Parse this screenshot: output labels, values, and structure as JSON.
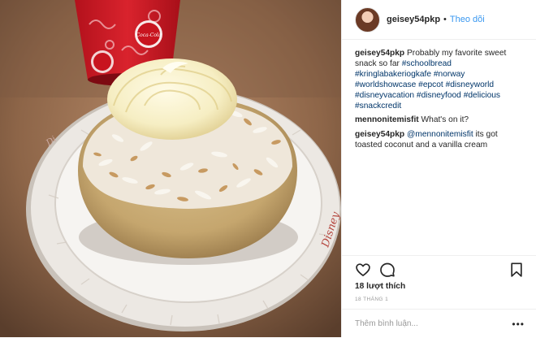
{
  "post": {
    "username": "geisey54pkp",
    "separator": "•",
    "follow_label": "Theo dõi"
  },
  "comments": [
    {
      "username": "geisey54pkp",
      "segments": [
        {
          "text": "Probably my favorite sweet snack so far ",
          "type": "text"
        },
        {
          "text": "#schoolbread",
          "type": "tag"
        },
        {
          "text": " ",
          "type": "text"
        },
        {
          "text": "#kringlabakeriogkafe",
          "type": "tag"
        },
        {
          "text": " ",
          "type": "text"
        },
        {
          "text": "#norway",
          "type": "tag"
        },
        {
          "text": " ",
          "type": "text"
        },
        {
          "text": "#worldshowcase",
          "type": "tag"
        },
        {
          "text": " ",
          "type": "text"
        },
        {
          "text": "#epcot",
          "type": "tag"
        },
        {
          "text": " ",
          "type": "text"
        },
        {
          "text": "#disneyworld",
          "type": "tag"
        },
        {
          "text": " ",
          "type": "text"
        },
        {
          "text": "#disneyvacation",
          "type": "tag"
        },
        {
          "text": " ",
          "type": "text"
        },
        {
          "text": "#disneyfood",
          "type": "tag"
        },
        {
          "text": " ",
          "type": "text"
        },
        {
          "text": "#delicious",
          "type": "tag"
        },
        {
          "text": " ",
          "type": "text"
        },
        {
          "text": "#snackcredit",
          "type": "tag"
        }
      ]
    },
    {
      "username": "mennonitemisfit",
      "segments": [
        {
          "text": "What's on it?",
          "type": "text"
        }
      ]
    },
    {
      "username": "geisey54pkp",
      "segments": [
        {
          "text": "@mennonitemisfit",
          "type": "tag"
        },
        {
          "text": " its got toasted coconut and a vanilla cream",
          "type": "text"
        }
      ]
    }
  ],
  "actions": {
    "like_icon": "heart-icon",
    "comment_icon": "comment-icon",
    "save_icon": "bookmark-icon"
  },
  "likes": "18 lượt thích",
  "date": "18 THÁNG 1",
  "add_comment": {
    "placeholder": "Thêm bình luận...",
    "more_label": "•••"
  },
  "photo": {
    "cup_text": "Coca-Cola",
    "plate_text": "Disney"
  }
}
